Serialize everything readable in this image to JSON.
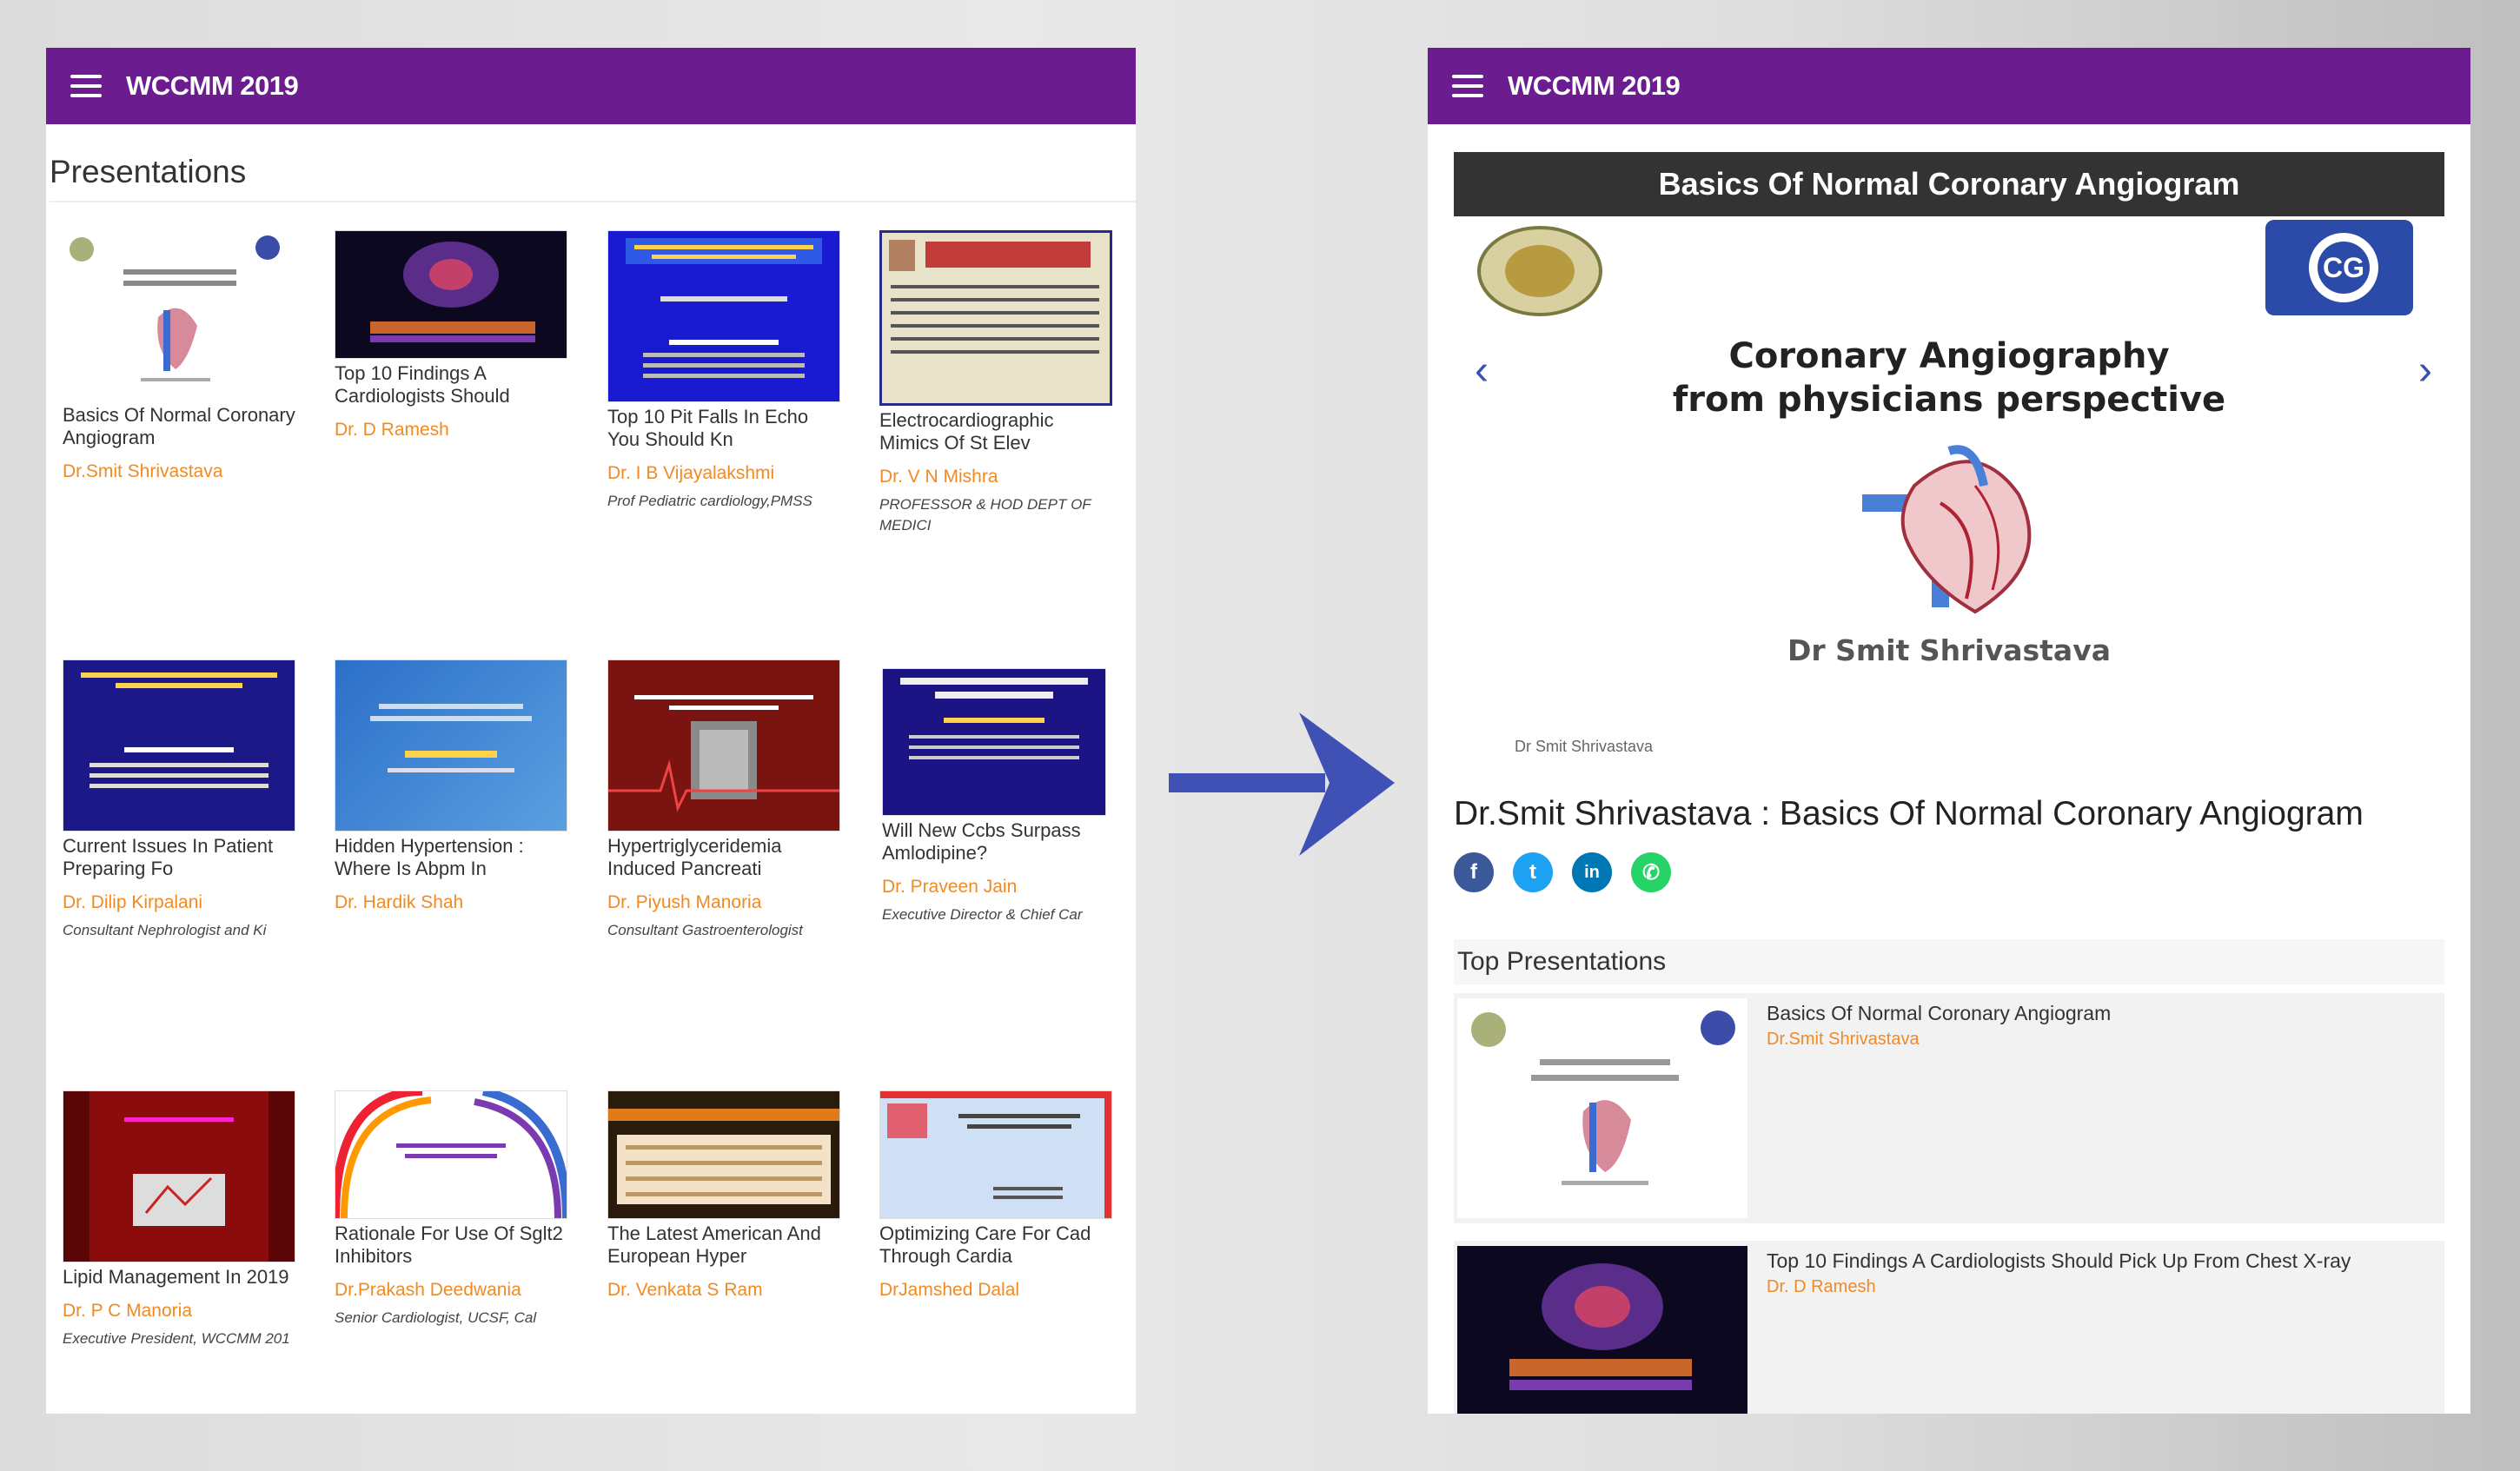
{
  "app": {
    "title": "WCCMM 2019"
  },
  "left": {
    "section_title": "Presentations",
    "cards": [
      {
        "title": "Basics Of Normal Coronary Angiogram",
        "author": "Dr.Smit Shrivastava",
        "designation": ""
      },
      {
        "title": "Top 10 Findings A Cardiologists Should",
        "author": "Dr. D Ramesh",
        "designation": ""
      },
      {
        "title": "Top 10 Pit Falls In Echo You Should Kn",
        "author": "Dr. I B Vijayalakshmi",
        "designation": "Prof Pediatric cardiology,PMSS"
      },
      {
        "title": "Electrocardiographic Mimics Of St Elev",
        "author": "Dr. V N Mishra",
        "designation": "PROFESSOR & HOD DEPT OF MEDICI"
      },
      {
        "title": "Current Issues In Patient Preparing Fo",
        "author": "Dr. Dilip Kirpalani",
        "designation": "Consultant Nephrologist and Ki"
      },
      {
        "title": "Hidden Hypertension : Where Is Abpm In",
        "author": "Dr. Hardik Shah",
        "designation": ""
      },
      {
        "title": "Hypertriglyceridemia Induced Pancreati",
        "author": "Dr. Piyush Manoria",
        "designation": "Consultant Gastroenterologist"
      },
      {
        "title": "Will New Ccbs Surpass Amlodipine?",
        "author": "Dr. Praveen Jain",
        "designation": "Executive Director & Chief Car"
      },
      {
        "title": "Lipid Management In 2019",
        "author": "Dr. P C Manoria",
        "designation": "Executive President, WCCMM 201"
      },
      {
        "title": "Rationale For Use Of Sglt2 Inhibitors",
        "author": "Dr.Prakash Deedwania",
        "designation": "Senior Cardiologist, UCSF, Cal"
      },
      {
        "title": "The Latest American And European Hyper",
        "author": "Dr. Venkata S Ram",
        "designation": ""
      },
      {
        "title": "Optimizing Care For Cad Through Cardia",
        "author": "DrJamshed Dalal",
        "designation": ""
      }
    ]
  },
  "right": {
    "hero_title": "Basics Of Normal Coronary Angiogram",
    "slide": {
      "line1": "Coronary Angiography",
      "line2": "from physicians perspective",
      "doctor": "Dr Smit Shrivastava",
      "small": "Dr Smit Shrivastava",
      "logo_right": "CG"
    },
    "presentation_title": "Dr.Smit Shrivastava : Basics Of Normal Coronary Angiogram",
    "share_icons": [
      "facebook",
      "twitter",
      "linkedin",
      "whatsapp"
    ],
    "top_header": "Top Presentations",
    "top": [
      {
        "title": "Basics Of Normal Coronary Angiogram",
        "author": "Dr.Smit Shrivastava"
      },
      {
        "title": "Top 10 Findings A Cardiologists Should Pick Up From Chest X-ray",
        "author": "Dr. D Ramesh"
      }
    ]
  },
  "colors": {
    "appbar": "#6b1c8f",
    "author": "#f08a24",
    "arrow": "#3f51b5"
  }
}
